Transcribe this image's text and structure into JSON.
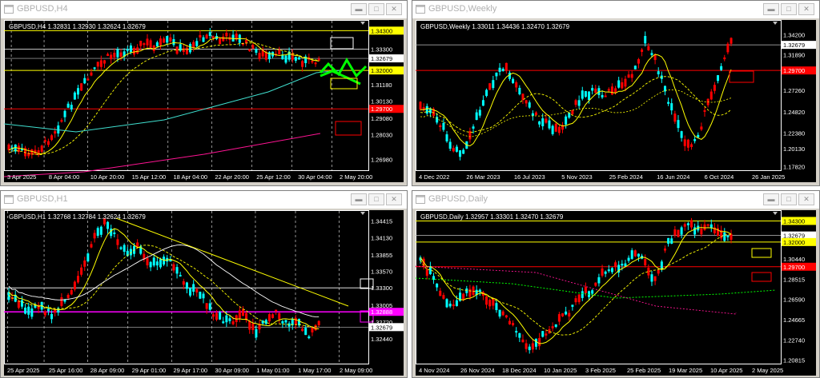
{
  "windows": [
    {
      "id": "h4",
      "title": "GBPUSD,H4",
      "info": "GBPUSD,H4  1.32831 1.32930 1.32624 1.32679",
      "current_price": "1.32679",
      "price_labels": [
        {
          "text": "1.34300",
          "bg": "#ffff00",
          "fg": "#000000",
          "v": 0.03
        },
        {
          "text": "1.33300",
          "bg": "",
          "fg": "#ffffff",
          "v": 0.16
        },
        {
          "text": "1.32679",
          "bg": "#ffffff",
          "fg": "#000000",
          "v": 0.225
        },
        {
          "text": "1.32000",
          "bg": "#ffff00",
          "fg": "#000000",
          "v": 0.31
        },
        {
          "text": "1.31180",
          "bg": "",
          "fg": "#ffffff",
          "v": 0.41
        },
        {
          "text": "1.30130",
          "bg": "",
          "fg": "#ffffff",
          "v": 0.525
        },
        {
          "text": "1.29700",
          "bg": "#ff0000",
          "fg": "#ffffff",
          "v": 0.58
        },
        {
          "text": "1.29080",
          "bg": "",
          "fg": "#ffffff",
          "v": 0.645
        },
        {
          "text": "1.28030",
          "bg": "",
          "fg": "#ffffff",
          "v": 0.76
        },
        {
          "text": "1.26980",
          "bg": "",
          "fg": "#ffffff",
          "v": 0.935
        }
      ],
      "time_labels": [
        "3 Apr 2025",
        "8 Apr 04:00",
        "10 Apr 20:00",
        "15 Apr 12:00",
        "18 Apr 04:00",
        "22 Apr 20:00",
        "25 Apr 12:00",
        "30 Apr 04:00",
        "2 May 20:00"
      ]
    },
    {
      "id": "weekly",
      "title": "GBPUSD,Weekly",
      "info": "GBPUSD,Weekly  1.33011 1.34436 1.32470 1.32679",
      "current_price": "1.32679",
      "price_labels": [
        {
          "text": "1.34200",
          "bg": "",
          "fg": "#ffffff",
          "v": 0.06
        },
        {
          "text": "1.32679",
          "bg": "#ffffff",
          "fg": "#000000",
          "v": 0.13
        },
        {
          "text": "1.31890",
          "bg": "",
          "fg": "#ffffff",
          "v": 0.2
        },
        {
          "text": "1.29700",
          "bg": "#ff0000",
          "fg": "#ffffff",
          "v": 0.31
        },
        {
          "text": "1.27260",
          "bg": "",
          "fg": "#ffffff",
          "v": 0.45
        },
        {
          "text": "1.24820",
          "bg": "",
          "fg": "#ffffff",
          "v": 0.6
        },
        {
          "text": "1.22380",
          "bg": "",
          "fg": "#ffffff",
          "v": 0.75
        },
        {
          "text": "1.20130",
          "bg": "",
          "fg": "#ffffff",
          "v": 0.86
        },
        {
          "text": "1.17820",
          "bg": "",
          "fg": "#ffffff",
          "v": 0.985
        }
      ],
      "time_labels": [
        "4 Dec 2022",
        "26 Mar 2023",
        "16 Jul 2023",
        "5 Nov 2023",
        "25 Feb 2024",
        "16 Jun 2024",
        "6 Oct 2024",
        "26 Jan 2025"
      ]
    },
    {
      "id": "h1",
      "title": "GBPUSD,H1",
      "info": "GBPUSD,H1  1.32768 1.32784 1.32624 1.32679",
      "current_price": "1.32679",
      "price_labels": [
        {
          "text": "1.34415",
          "bg": "",
          "fg": "#ffffff",
          "v": 0.03
        },
        {
          "text": "1.34130",
          "bg": "",
          "fg": "#ffffff",
          "v": 0.145
        },
        {
          "text": "1.33855",
          "bg": "",
          "fg": "#ffffff",
          "v": 0.265
        },
        {
          "text": "1.33570",
          "bg": "",
          "fg": "#ffffff",
          "v": 0.375
        },
        {
          "text": "1.33300",
          "bg": "",
          "fg": "#ffffff",
          "v": 0.49
        },
        {
          "text": "1.33005",
          "bg": "",
          "fg": "#ffffff",
          "v": 0.61
        },
        {
          "text": "1.32888",
          "bg": "#ff00ff",
          "fg": "#ffffff",
          "v": 0.655
        },
        {
          "text": "1.32720",
          "bg": "",
          "fg": "#ffffff",
          "v": 0.725
        },
        {
          "text": "1.32679",
          "bg": "#ffffff",
          "fg": "#000000",
          "v": 0.76
        },
        {
          "text": "1.32440",
          "bg": "",
          "fg": "#ffffff",
          "v": 0.84
        }
      ],
      "time_labels": [
        "25 Apr 2025",
        "25 Apr 16:00",
        "28 Apr 09:00",
        "29 Apr 01:00",
        "29 Apr 17:00",
        "30 Apr 09:00",
        "1 May 01:00",
        "1 May 17:00",
        "2 May 09:00"
      ]
    },
    {
      "id": "daily",
      "title": "GBPUSD,Daily",
      "info": "GBPUSD,Daily  1.32957 1.33301 1.32470 1.32679",
      "current_price": "1.32679",
      "price_labels": [
        {
          "text": "1.34300",
          "bg": "#ffff00",
          "fg": "#000000",
          "v": 0.03
        },
        {
          "text": "1.32679",
          "bg": "#ffffff",
          "fg": "#000000",
          "v": 0.13
        },
        {
          "text": "1.32000",
          "bg": "#ffff00",
          "fg": "#000000",
          "v": 0.175
        },
        {
          "text": "1.30440",
          "bg": "",
          "fg": "#ffffff",
          "v": 0.29
        },
        {
          "text": "1.29700",
          "bg": "#ff0000",
          "fg": "#ffffff",
          "v": 0.345
        },
        {
          "text": "1.28515",
          "bg": "",
          "fg": "#ffffff",
          "v": 0.43
        },
        {
          "text": "1.26590",
          "bg": "",
          "fg": "#ffffff",
          "v": 0.57
        },
        {
          "text": "1.24665",
          "bg": "",
          "fg": "#ffffff",
          "v": 0.71
        },
        {
          "text": "1.22740",
          "bg": "",
          "fg": "#ffffff",
          "v": 0.85
        },
        {
          "text": "1.20815",
          "bg": "",
          "fg": "#ffffff",
          "v": 0.985
        }
      ],
      "time_labels": [
        "4 Nov 2024",
        "26 Nov 2024",
        "18 Dec 2024",
        "10 Jan 2025",
        "3 Feb 2025",
        "25 Feb 2025",
        "19 Mar 2025",
        "10 Apr 2025",
        "2 May 2025"
      ]
    }
  ],
  "colors": {
    "bull": "#00ffff",
    "bear": "#ff0000",
    "trend": "#ffff00",
    "background": "#000000"
  },
  "icons": [
    "minimize-icon",
    "maximize-icon",
    "close-icon",
    "window-icon"
  ]
}
